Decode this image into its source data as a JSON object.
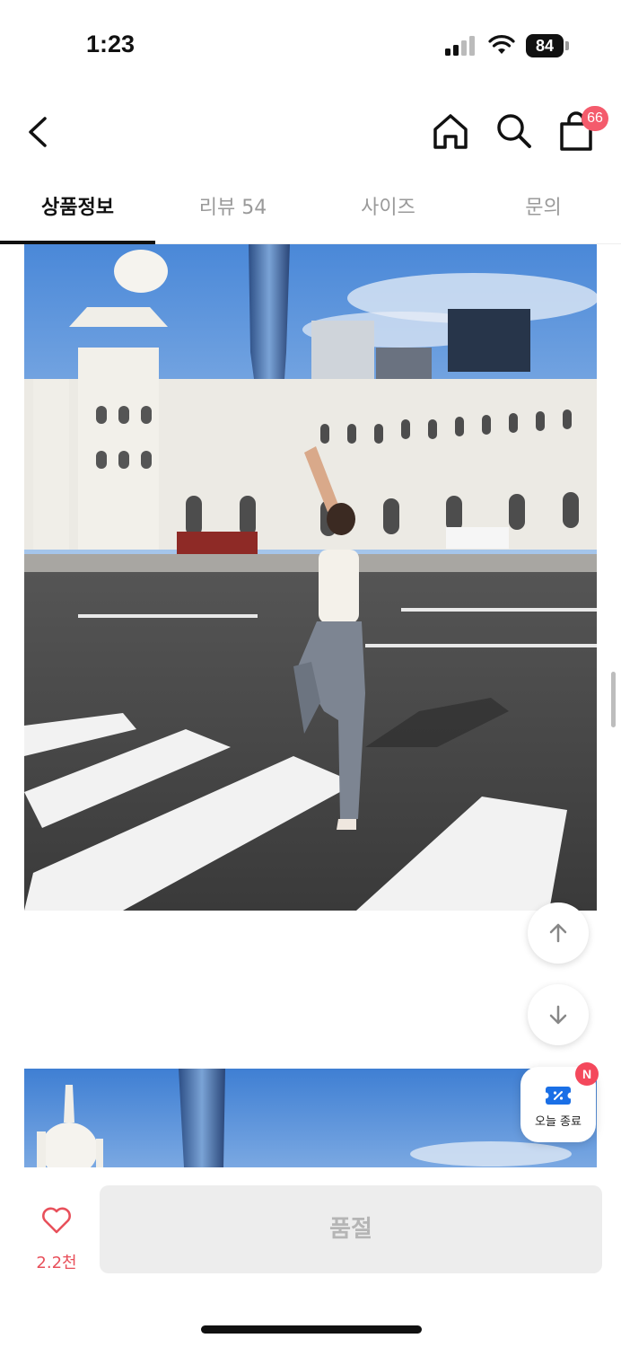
{
  "status_bar": {
    "time": "1:23",
    "battery": "84"
  },
  "header": {
    "back_icon": "chevron-left-icon",
    "home_icon": "home-icon",
    "search_icon": "search-icon",
    "cart_icon": "shopping-bag-icon",
    "cart_count": "66"
  },
  "tabs": [
    {
      "label": "상품정보",
      "active": true
    },
    {
      "label": "리뷰 54",
      "active": false
    },
    {
      "label": "사이즈",
      "active": false
    },
    {
      "label": "문의",
      "active": false
    }
  ],
  "floating": {
    "scroll_up_icon": "arrow-up-icon",
    "scroll_down_icon": "arrow-down-icon",
    "coupon_label": "오늘 종료",
    "coupon_badge": "N"
  },
  "bottom_bar": {
    "like_icon": "heart-icon",
    "like_count": "2.2천",
    "buy_label": "품절"
  },
  "colors": {
    "accent": "#f45b6c",
    "heart": "#e8505b",
    "coupon_blue": "#1a6fe6",
    "disabled_button": "#ededed"
  }
}
